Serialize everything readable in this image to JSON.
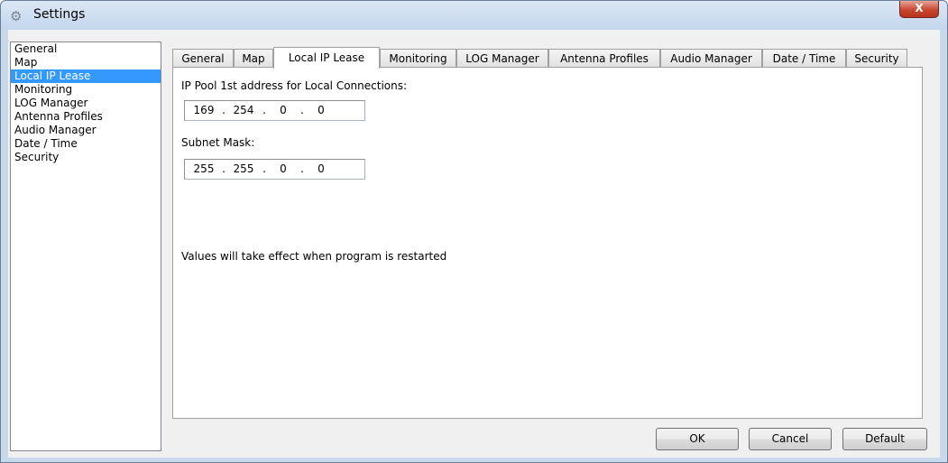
{
  "window": {
    "title": "Settings",
    "close_label": "X"
  },
  "sidebar": {
    "items": [
      {
        "label": "General"
      },
      {
        "label": "Map"
      },
      {
        "label": "Local IP Lease",
        "selected": true
      },
      {
        "label": "Monitoring"
      },
      {
        "label": "LOG Manager"
      },
      {
        "label": "Antenna Profiles"
      },
      {
        "label": "Audio Manager"
      },
      {
        "label": "Date / Time"
      },
      {
        "label": "Security"
      }
    ]
  },
  "tabs": [
    {
      "label": "General"
    },
    {
      "label": "Map"
    },
    {
      "label": "Local IP Lease",
      "active": true
    },
    {
      "label": "Monitoring"
    },
    {
      "label": "LOG Manager"
    },
    {
      "label": "Antenna Profiles"
    },
    {
      "label": "Audio Manager"
    },
    {
      "label": "Date / Time"
    },
    {
      "label": "Security"
    }
  ],
  "panel": {
    "ip_pool_label": "IP Pool 1st address for Local Connections:",
    "ip_pool": {
      "o1": "169",
      "o2": "254",
      "o3": "0",
      "o4": "0"
    },
    "subnet_label": "Subnet Mask:",
    "subnet": {
      "o1": "255",
      "o2": "255",
      "o3": "0",
      "o4": "0"
    },
    "separator": ".",
    "note": "Values will take effect when program is restarted"
  },
  "buttons": {
    "ok": "OK",
    "cancel": "Cancel",
    "default": "Default"
  },
  "icons": {
    "title_icon": "gears-icon",
    "close_icon": "close-icon"
  },
  "colors": {
    "selection": "#3399ff",
    "titlebar": "#c4d6ec",
    "close": "#c8462f"
  }
}
